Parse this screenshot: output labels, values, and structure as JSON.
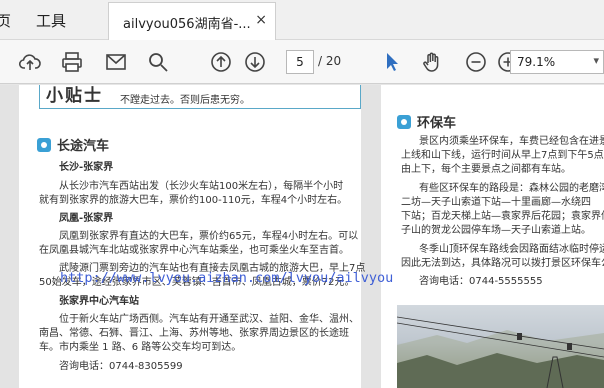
{
  "menu": {
    "item1": "页",
    "item2": "工具"
  },
  "tab": {
    "title": "ailvyou056湖南省-...",
    "close": "×"
  },
  "toolbar": {
    "page_current": "5",
    "page_total": "/ 20",
    "zoom": "79.1%"
  },
  "left_page": {
    "banner_title": "小贴士",
    "banner_text": "不蹚走过去。否则后患无穷。",
    "section_title": "长途汽车",
    "sub1": "长沙-张家界",
    "p1_l1": "从长沙市汽车西站出发（长沙火车站100米左右），每隔半个小时",
    "p1_l2": "就有到张家界的旅游大巴车，票价约100-110元，车程4个小时左右。",
    "sub2": "凤凰-张家界",
    "p2_l1": "凤凰到张家界有直达的大巴车，票价约65元，车程4小时左右。可以",
    "p2_l2": "在凤凰县城汽车北站或张家界中心汽车站乘坐，也可乘坐火车至吉首。",
    "p3_l1": "武陵源门票到旁边的汽车站也有直接去凤凰古城的旅游大巴，早上7点",
    "p3_l2": "50始发车，途经张家界市区、芙蓉镇、吉首市、凤凰古城，票价72元。",
    "sub3": "张家界中心汽车站",
    "p4_l1": "位于新火车站广场西侧。汽车站有开通至武汉、益阳、金华、温州、",
    "p4_l2": "南昌、常德、石狮、晋江、上海、苏州等地、张家界周边景区的长途班",
    "p4_l3": "车。市内乘坐 1 路、6 路等公交车均可到达。",
    "phone": "咨询电话：0744-8305599"
  },
  "watermark": "http://www.lvyou.aizhan.com/lvyou/ailvyou",
  "right_page": {
    "section_title": "环保车",
    "p1_l1": "景区内须乘坐环保车，车费已经包含在进景",
    "p1_l2": "上线和山下线，运行时间从早上7点到下午5点，",
    "p1_l3": "由上下，每个主要景点之间都有车站。",
    "p2_l1": "有些区环保车的路段是：森林公园的老磨湾",
    "p2_l2": "二坊—天子山索道下站—十里画廊—水绕四",
    "p2_l3": "下站；百龙天梯上站—袁家界后花园；袁家界停",
    "p2_l4": "子山的贺龙公园停车场—天子山索道上站。",
    "p3_l1": "冬季山顶环保车路线会因路面结冰临时停运",
    "p3_l2": "因此无法到达，具体路况可以拨打景区环保车公",
    "phone": "咨询电话：0744-5555555"
  }
}
